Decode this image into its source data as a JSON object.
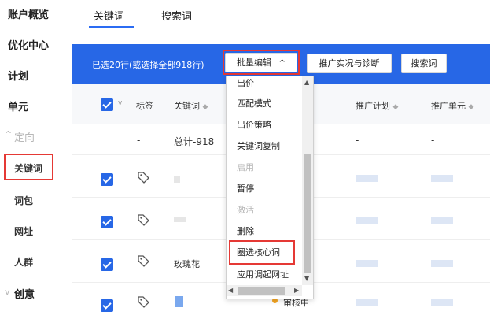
{
  "sidebar": {
    "items": [
      {
        "label": "账户概览"
      },
      {
        "label": "优化中心"
      },
      {
        "label": "计划"
      },
      {
        "label": "单元"
      },
      {
        "label": "定向"
      },
      {
        "label": "关键词"
      },
      {
        "label": "词包"
      },
      {
        "label": "网址"
      },
      {
        "label": "人群"
      },
      {
        "label": "创意"
      }
    ]
  },
  "tabs": [
    {
      "label": "关键词"
    },
    {
      "label": "搜索词"
    }
  ],
  "toolbar": {
    "selection_text": "已选20行(或选择全部918行)",
    "batch_edit_label": "批量编辑",
    "diagnose_label": "推广实况与诊断",
    "search_terms_label": "搜索词"
  },
  "table": {
    "headers": {
      "tag": "标签",
      "keyword": "关键词",
      "plan": "推广计划",
      "unit": "推广单元"
    },
    "total_row": {
      "dash1": "-",
      "keyword": "总计-918",
      "dash2": "-",
      "dash3": "-"
    },
    "rows": [
      {
        "keyword": ""
      },
      {
        "keyword": ""
      },
      {
        "keyword": "玫瑰花"
      },
      {
        "keyword": "",
        "status": "审核中"
      }
    ]
  },
  "dropdown": {
    "items": [
      {
        "label": "出价",
        "disabled": false
      },
      {
        "label": "匹配模式",
        "disabled": false
      },
      {
        "label": "出价策略",
        "disabled": false
      },
      {
        "label": "关键词复制",
        "disabled": false
      },
      {
        "label": "启用",
        "disabled": true
      },
      {
        "label": "暂停",
        "disabled": false
      },
      {
        "label": "激活",
        "disabled": true
      },
      {
        "label": "删除",
        "disabled": false
      },
      {
        "label": "圈选核心词",
        "disabled": false
      },
      {
        "label": "应用调起网址",
        "disabled": false
      }
    ]
  },
  "colors": {
    "accent": "#2767e6",
    "highlight": "#e53935",
    "status_pending": "#f5a623"
  }
}
